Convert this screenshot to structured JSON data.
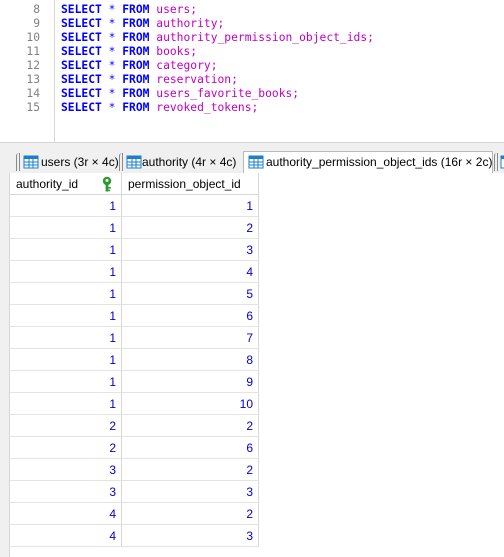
{
  "editor": {
    "lines": [
      {
        "no": "8",
        "kw1": "SELECT",
        "op": "*",
        "kw2": "FROM",
        "table": "users;"
      },
      {
        "no": "9",
        "kw1": "SELECT",
        "op": "*",
        "kw2": "FROM",
        "table": "authority;"
      },
      {
        "no": "10",
        "kw1": "SELECT",
        "op": "*",
        "kw2": "FROM",
        "table": "authority_permission_object_ids;"
      },
      {
        "no": "11",
        "kw1": "SELECT",
        "op": "*",
        "kw2": "FROM",
        "table": "books;"
      },
      {
        "no": "12",
        "kw1": "SELECT",
        "op": "*",
        "kw2": "FROM",
        "table": "category;"
      },
      {
        "no": "13",
        "kw1": "SELECT",
        "op": "*",
        "kw2": "FROM",
        "table": "reservation;"
      },
      {
        "no": "14",
        "kw1": "SELECT",
        "op": "*",
        "kw2": "FROM",
        "table": "users_favorite_books;"
      },
      {
        "no": "15",
        "kw1": "SELECT",
        "op": "*",
        "kw2": "FROM",
        "table": "revoked_tokens;"
      }
    ]
  },
  "tabs": [
    {
      "label": "users (3r × 4c)",
      "active": false
    },
    {
      "label": "authority (4r × 4c)",
      "active": false
    },
    {
      "label": "authority_permission_object_ids (16r × 2c)",
      "active": true
    }
  ],
  "grid": {
    "columns": [
      "authority_id",
      "permission_object_id"
    ],
    "rows": [
      [
        "1",
        "1"
      ],
      [
        "1",
        "2"
      ],
      [
        "1",
        "3"
      ],
      [
        "1",
        "4"
      ],
      [
        "1",
        "5"
      ],
      [
        "1",
        "6"
      ],
      [
        "1",
        "7"
      ],
      [
        "1",
        "8"
      ],
      [
        "1",
        "9"
      ],
      [
        "1",
        "10"
      ],
      [
        "2",
        "2"
      ],
      [
        "2",
        "6"
      ],
      [
        "3",
        "2"
      ],
      [
        "3",
        "3"
      ],
      [
        "4",
        "2"
      ],
      [
        "4",
        "3"
      ]
    ]
  },
  "colors": {
    "keyword": "#0000ff",
    "identifier": "#c000c0",
    "cell_value": "#0000d0",
    "key_icon": "#2e9a2e",
    "table_icon": "#1e7fc8"
  },
  "icons": {
    "tab_icon": "table-grid-icon",
    "primary_key_icon": "key-icon"
  }
}
